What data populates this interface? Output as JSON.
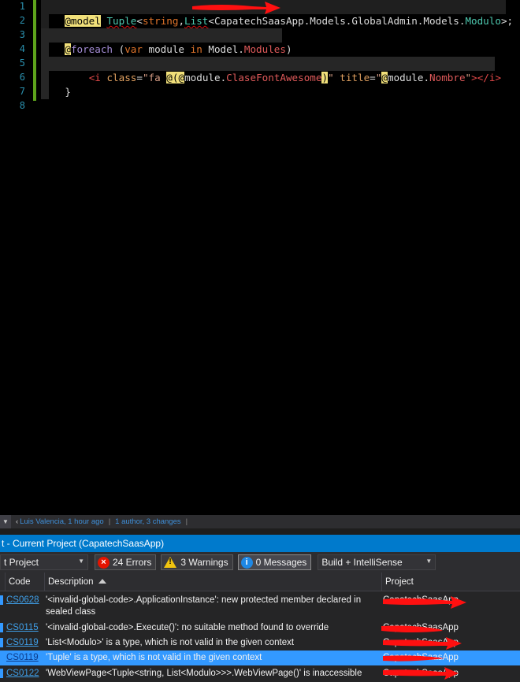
{
  "editor": {
    "line_numbers": [
      "1",
      "2",
      "3",
      "4",
      "5",
      "6",
      "7",
      "8"
    ],
    "line1": {
      "razor": "@model",
      "tuple": "Tuple",
      "lt1": "<",
      "string": "string",
      "comma": ",",
      "list": "List",
      "lt2": "<",
      "obscured": "CapatechSaasApp",
      "ns": ".Models.GlobalAdmin.Models.",
      "modulo": "Modulo",
      "end": ">;"
    },
    "line3": {
      "razor": "@",
      "foreach": "foreach",
      "open": " (",
      "var": "var",
      "module": " module ",
      "in": "in",
      "model": " Model.",
      "modules": "Modules",
      "close": ")"
    },
    "line4": {
      "brace": "{"
    },
    "line5": {
      "indent": "    ",
      "open_tag": "<i",
      "attr_class": " class",
      "eq1": "=",
      "val1": "\"fa ",
      "r1": "@",
      "paren": "(",
      "r2": "@",
      "mod1": "module.",
      "clase": "ClaseFontAwesome",
      "close_paren": ")",
      "quote1": "\"",
      "attr_title": " title",
      "eq2": "=",
      "quote2": "\"",
      "r3": "@",
      "mod2": "module.",
      "nombre": "Nombre",
      "quote3": "\"",
      "gt": ">",
      "end_tag": "</i>"
    },
    "line6": {
      "brace": "}"
    }
  },
  "blame": {
    "author": "Luis Valencia, 1 hour ago",
    "summary": "1 author, 3 changes"
  },
  "error_list": {
    "title": "t - Current Project (CapatechSaasApp)",
    "scope": "t Project",
    "errors": "24 Errors",
    "warnings": "3 Warnings",
    "messages": "0 Messages",
    "build_filter": "Build + IntelliSense",
    "columns": {
      "code": "Code",
      "description": "Description",
      "project": "Project"
    },
    "rows": [
      {
        "code": "CS0628",
        "description": "'<invalid-global-code>.ApplicationInstance': new protected member declared in sealed class",
        "project": "CapatechSaasApp"
      },
      {
        "code": "CS0115",
        "description": "'<invalid-global-code>.Execute()': no suitable method found to override",
        "project": "CapatechSaasApp"
      },
      {
        "code": "CS0119",
        "description": "'List<Modulo>' is a type, which is not valid in the given context",
        "project": "CapatechSaasApp"
      },
      {
        "code": "CS0119",
        "description": "'Tuple' is a type, which is not valid in the given context",
        "project": "CapatechSaasApp"
      },
      {
        "code": "CS0122",
        "description": "'WebViewPage<Tuple<string, List<Modulo>>>.WebViewPage()' is inaccessible",
        "project": "CapatechSaasApp"
      }
    ]
  },
  "colors": {
    "accent": "#007acc",
    "selection": "#3399ff",
    "error": "#e51400",
    "annotation_arrow": "#ff0000"
  }
}
